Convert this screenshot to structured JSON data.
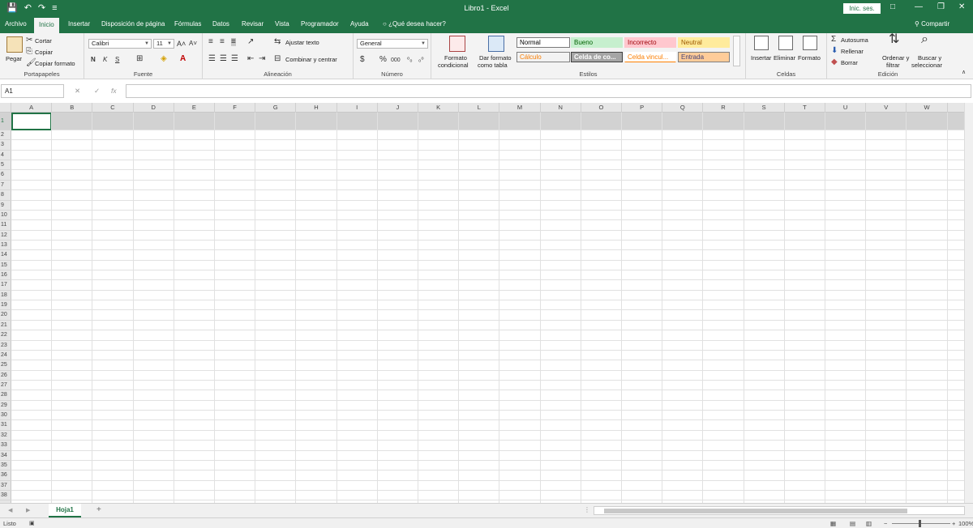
{
  "window": {
    "title": "Libro1  -  Excel",
    "signin_label": "Inic. ses.",
    "minimize": "—",
    "restore": "❐",
    "close": "✕",
    "restore_down": "□"
  },
  "quick_access": {
    "save": "💾",
    "undo": "↶",
    "redo": "↷",
    "customize": "≡"
  },
  "tabs": [
    {
      "label": "Archivo"
    },
    {
      "label": "Inicio"
    },
    {
      "label": "Insertar"
    },
    {
      "label": "Disposición de página"
    },
    {
      "label": "Fórmulas"
    },
    {
      "label": "Datos"
    },
    {
      "label": "Revisar"
    },
    {
      "label": "Vista"
    },
    {
      "label": "Programador"
    },
    {
      "label": "Ayuda"
    }
  ],
  "tell_me": "¿Qué desea hacer?",
  "share": "Compartir",
  "ribbon": {
    "clipboard": {
      "paste": "Pegar",
      "cut": "Cortar",
      "copy": "Copiar",
      "format_painter": "Copiar formato",
      "group_label": "Portapapeles"
    },
    "font": {
      "name": "Calibri",
      "size": "11",
      "bold": "N",
      "italic": "K",
      "underline": "S",
      "group_label": "Fuente"
    },
    "alignment": {
      "wrap": "Ajustar texto",
      "merge": "Combinar y centrar",
      "group_label": "Alineación"
    },
    "number": {
      "format": "General",
      "group_label": "Número",
      "currency": "$",
      "percent": "%",
      "comma": "000"
    },
    "styles": {
      "conditional_1": "Formato",
      "conditional_2": "condicional",
      "table_1": "Dar formato",
      "table_2": "como tabla",
      "cells": [
        {
          "label": "Normal"
        },
        {
          "label": "Bueno"
        },
        {
          "label": "Incorrecto"
        },
        {
          "label": "Neutral"
        },
        {
          "label": "Cálculo"
        },
        {
          "label": "Celda de co..."
        },
        {
          "label": "Celda vincul..."
        },
        {
          "label": "Entrada"
        }
      ],
      "group_label": "Estilos"
    },
    "cells": {
      "insert": "Insertar",
      "delete": "Eliminar",
      "format": "Formato",
      "group_label": "Celdas"
    },
    "editing": {
      "autosum": "Autosuma",
      "fill": "Rellenar",
      "clear": "Borrar",
      "sort_1": "Ordenar y",
      "sort_2": "filtrar",
      "find_1": "Buscar y",
      "find_2": "seleccionar",
      "group_label": "Edición"
    }
  },
  "formula_bar": {
    "name_box": "A1",
    "cancel": "✕",
    "enter": "✓",
    "fx": "fx",
    "content": ""
  },
  "columns": [
    "A",
    "B",
    "C",
    "D",
    "E",
    "F",
    "G",
    "H",
    "I",
    "J",
    "K",
    "L",
    "M",
    "N",
    "O",
    "P",
    "Q",
    "R",
    "S",
    "T",
    "U",
    "V",
    "W"
  ],
  "rows": [
    "1",
    "2",
    "3",
    "4",
    "5",
    "6",
    "7",
    "8",
    "9",
    "10",
    "11",
    "12",
    "13",
    "14",
    "15",
    "16",
    "17",
    "18",
    "19",
    "20",
    "21",
    "22",
    "23",
    "24",
    "25",
    "26",
    "27",
    "28",
    "29",
    "30",
    "31",
    "32",
    "33",
    "34",
    "35",
    "36",
    "37",
    "38"
  ],
  "sheets": [
    {
      "label": "Hoja1"
    }
  ],
  "add_sheet": "+",
  "status": {
    "ready": "Listo",
    "zoom": "100%"
  }
}
